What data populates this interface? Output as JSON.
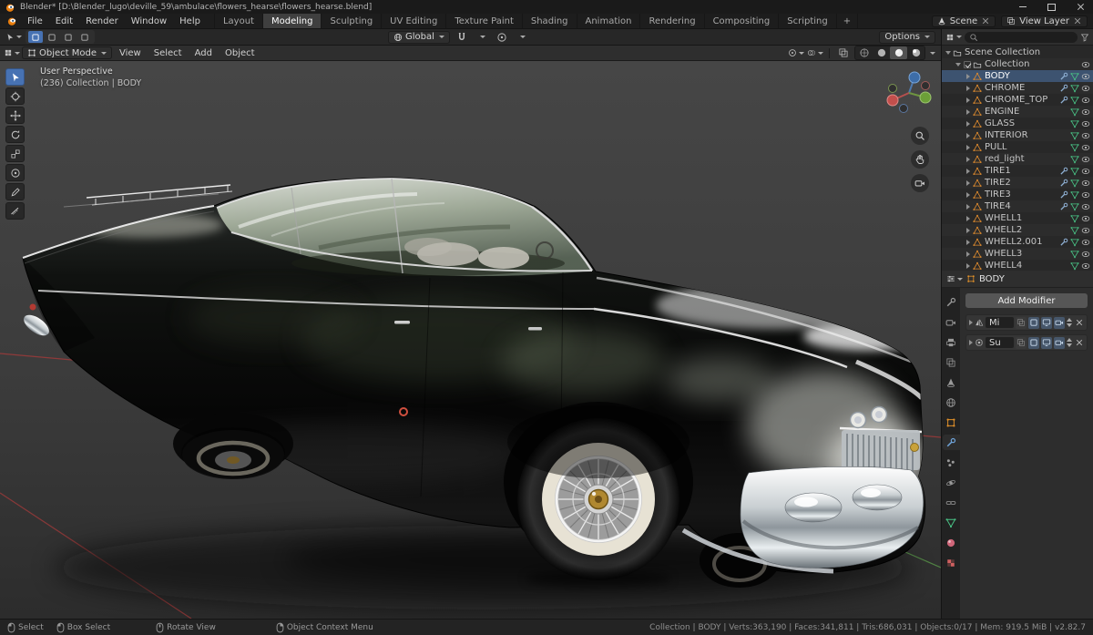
{
  "titlebar": {
    "title": "Blender* [D:\\Blender_lugo\\deville_59\\ambulace\\flowers_hearse\\flowers_hearse.blend]"
  },
  "menubar": {
    "menus": [
      {
        "label": "File"
      },
      {
        "label": "Edit"
      },
      {
        "label": "Render"
      },
      {
        "label": "Window"
      },
      {
        "label": "Help"
      }
    ],
    "tabs": [
      {
        "label": "Layout"
      },
      {
        "label": "Modeling"
      },
      {
        "label": "Sculpting"
      },
      {
        "label": "UV Editing"
      },
      {
        "label": "Texture Paint"
      },
      {
        "label": "Shading"
      },
      {
        "label": "Animation"
      },
      {
        "label": "Rendering"
      },
      {
        "label": "Compositing"
      },
      {
        "label": "Scripting"
      }
    ],
    "active_tab": "Modeling",
    "add_workspace": "+",
    "scene": {
      "label": "Scene"
    },
    "view_layer": {
      "label": "View Layer"
    }
  },
  "topbar": {
    "orientation": "Global",
    "options": "Options"
  },
  "viewport": {
    "header": {
      "mode": "Object Mode",
      "menus": [
        {
          "label": "View"
        },
        {
          "label": "Select"
        },
        {
          "label": "Add"
        },
        {
          "label": "Object"
        }
      ]
    },
    "overlay": {
      "line1": "User Perspective",
      "line2": "(236) Collection | BODY"
    }
  },
  "outliner": {
    "root": "Scene Collection",
    "collection": "Collection",
    "items": [
      {
        "name": "BODY"
      },
      {
        "name": "CHROME"
      },
      {
        "name": "CHROME_TOP"
      },
      {
        "name": "ENGINE"
      },
      {
        "name": "GLASS"
      },
      {
        "name": "INTERIOR"
      },
      {
        "name": "PULL"
      },
      {
        "name": "red_light"
      },
      {
        "name": "TIRE1"
      },
      {
        "name": "TIRE2"
      },
      {
        "name": "TIRE3"
      },
      {
        "name": "TIRE4"
      },
      {
        "name": "WHELL1"
      },
      {
        "name": "WHELL2"
      },
      {
        "name": "WHELL2.001"
      },
      {
        "name": "WHELL3"
      },
      {
        "name": "WHELL4"
      }
    ]
  },
  "properties": {
    "active_object": "BODY",
    "add_modifier": "Add Modifier",
    "modifiers": [
      {
        "name": "Mi"
      },
      {
        "name": "Su"
      }
    ]
  },
  "statusbar": {
    "hints": [
      {
        "label": "Select"
      },
      {
        "label": "Box Select"
      },
      {
        "label": "Rotate View"
      },
      {
        "label": "Object Context Menu"
      }
    ],
    "stats": "Collection | BODY | Verts:363,190 | Faces:341,811 | Tris:686,031 | Objects:0/17 | Mem: 919.5 MiB | v2.82.7"
  },
  "colors": {
    "accent": "#4772b3",
    "object_orange": "#e0902a",
    "axis_x_red": "#a43a3a",
    "axis_y_green": "#5a9a4a"
  }
}
